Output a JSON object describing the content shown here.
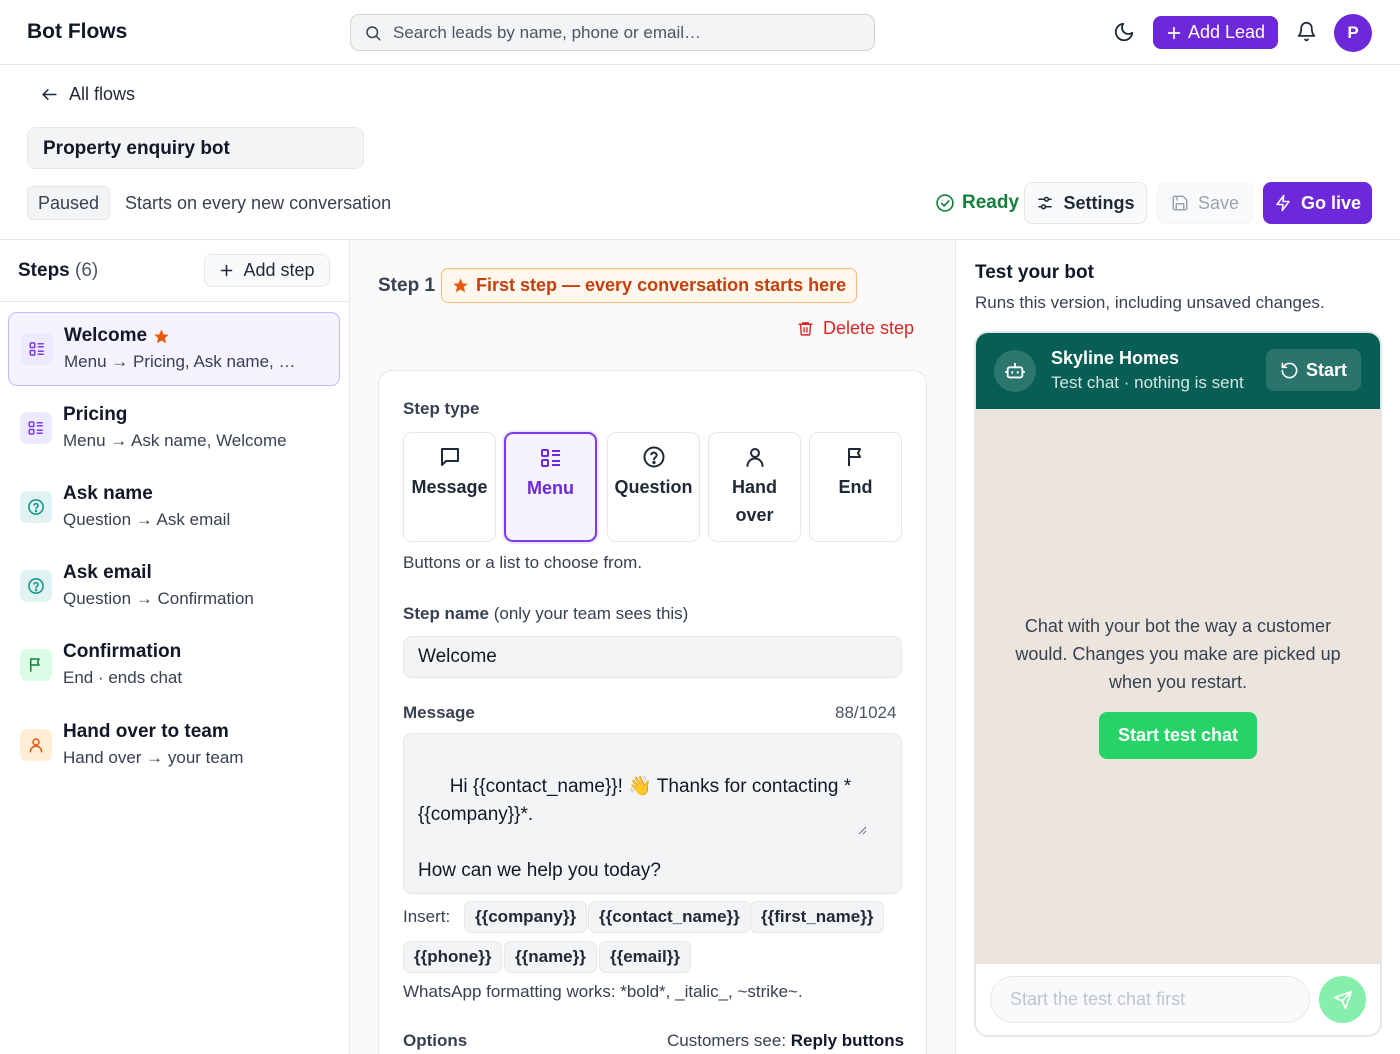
{
  "topbar": {
    "title": "Bot Flows",
    "search_placeholder": "Search leads by name, phone or email…",
    "add_lead_label": "Add Lead",
    "avatar_initial": "P"
  },
  "header": {
    "back_label": "All flows",
    "flow_name": "Property enquiry bot",
    "status_badge": "Paused",
    "trigger_text": "Starts on every new conversation",
    "ready_label": "Ready",
    "settings_label": "Settings",
    "save_label": "Save",
    "golive_label": "Go live"
  },
  "steps_panel": {
    "title": "Steps",
    "count": "(6)",
    "add_step_label": "Add step",
    "items": [
      {
        "title": "Welcome",
        "sub": "Menu → Pricing, Ask name, …",
        "icon": "menu-icon",
        "starred": true
      },
      {
        "title": "Pricing",
        "sub": "Menu → Ask name, Welcome",
        "icon": "menu-icon"
      },
      {
        "title": "Ask name",
        "sub": "Question → Ask email",
        "icon": "question-icon"
      },
      {
        "title": "Ask email",
        "sub": "Question → Confirmation",
        "icon": "question-icon"
      },
      {
        "title": "Confirmation",
        "sub": "End · ends chat",
        "icon": "flag-icon"
      },
      {
        "title": "Hand over to team",
        "sub": "Hand over → your team",
        "icon": "user-icon"
      }
    ]
  },
  "editor": {
    "step_number": "Step 1",
    "first_step_badge": "First step — every conversation starts here",
    "delete_label": "Delete step",
    "step_type_label": "Step type",
    "types": [
      {
        "label": "Message",
        "icon": "message-icon"
      },
      {
        "label": "Menu",
        "icon": "menu-icon",
        "selected": true
      },
      {
        "label": "Question",
        "icon": "question-icon"
      },
      {
        "label": "Hand over",
        "icon": "user-icon"
      },
      {
        "label": "End",
        "icon": "flag-icon"
      }
    ],
    "type_help": "Buttons or a list to choose from.",
    "step_name_label": "Step name",
    "step_name_hint": "(only your team sees this)",
    "step_name_value": "Welcome",
    "message_label": "Message",
    "message_counter": "88/1024",
    "message_value": "Hi {{contact_name}}! 👋 Thanks for contacting *{{company}}*.\n\nHow can we help you today?",
    "insert_label": "Insert:",
    "insert_chips": [
      "{{company}}",
      "{{contact_name}}",
      "{{first_name}}",
      "{{phone}}",
      "{{name}}",
      "{{email}}"
    ],
    "format_help": "WhatsApp formatting works: *bold*, _italic_, ~strike~.",
    "options_label": "Options",
    "customers_see_label": "Customers see:",
    "customers_see_value": "Reply buttons"
  },
  "test_panel": {
    "title": "Test your bot",
    "subtitle": "Runs this version, including unsaved changes.",
    "business_name": "Skyline Homes",
    "chat_subtitle": "Test chat · nothing is sent",
    "start_label": "Start",
    "hint": "Chat with your bot the way a customer would. Changes you make are picked up when you restart.",
    "start_chat_label": "Start test chat",
    "input_placeholder": "Start the test chat first"
  },
  "colors": {
    "accent": "#6d28d9",
    "whatsapp_header": "#075e54",
    "whatsapp_green": "#25d366",
    "chat_bg": "#ece5dd",
    "ready_green": "#15803d",
    "danger": "#dc2626"
  }
}
